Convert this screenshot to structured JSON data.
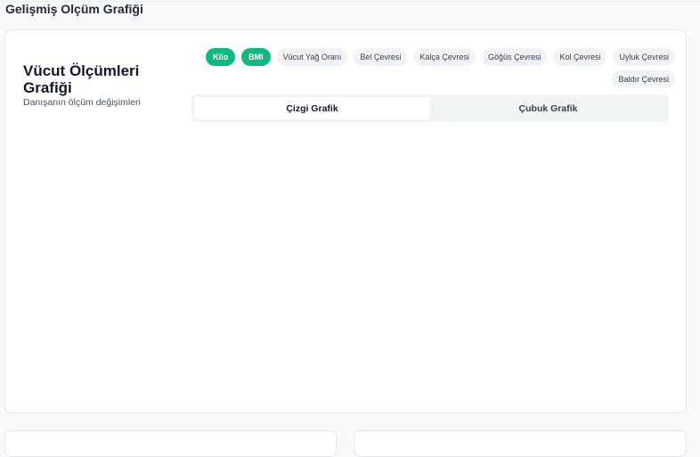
{
  "page": {
    "title": "Gelişmiş Olçüm Grafiği"
  },
  "card": {
    "title": "Vücut Ölçümleri Grafiği",
    "subtitle": "Danışanın ölçüm değişimleri"
  },
  "metrics": [
    {
      "label": "Kilo",
      "active": true
    },
    {
      "label": "BMI",
      "active": true
    },
    {
      "label": "Vücut Yağ Oranı",
      "active": false
    },
    {
      "label": "Bel Çevresi",
      "active": false
    },
    {
      "label": "Kalça Çevresi",
      "active": false
    },
    {
      "label": "Göğüs Çevresi",
      "active": false
    },
    {
      "label": "Kol Çevresi",
      "active": false
    },
    {
      "label": "Uyluk Çevresi",
      "active": false
    },
    {
      "label": "Baldır Çevresi",
      "active": false
    }
  ],
  "tabs": [
    {
      "label": "Çizgi Grafik",
      "active": true
    },
    {
      "label": "Çubuk Grafik",
      "active": false
    }
  ],
  "colors": {
    "accent": "#10b981",
    "chip_bg": "#f1f3f4",
    "tab_bg": "#f1f4f4"
  }
}
